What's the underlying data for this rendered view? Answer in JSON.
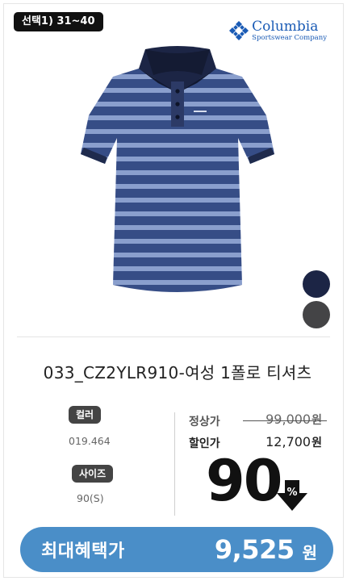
{
  "badge": {
    "label": "선택1) 31~40"
  },
  "brand": {
    "name": "Columbia",
    "tagline": "Sportswear Company",
    "color": "#1a5bb5",
    "icon": "columbia-diamond-icon"
  },
  "product": {
    "title": "033_CZ2YLR910-여성 1폴로 티셔츠",
    "image": "navy-blue-striped-polo-shirt",
    "swatches": [
      {
        "name": "navy",
        "color": "#1c2545"
      },
      {
        "name": "charcoal",
        "color": "#444446"
      }
    ]
  },
  "attributes": {
    "color_label": "컬러",
    "color_value": "019.464",
    "size_label": "사이즈",
    "size_value": "90(S)"
  },
  "pricing": {
    "regular_label": "정상가",
    "regular_price": "99,000",
    "sale_label": "할인가",
    "sale_price": "12,700",
    "currency": "원",
    "discount_number": "90",
    "discount_symbol": "%",
    "discount_icon": "percent-down-arrow-icon"
  },
  "cta": {
    "label": "최대혜택가",
    "price": "9,525",
    "currency": "원",
    "color": "#4a8ec8"
  }
}
